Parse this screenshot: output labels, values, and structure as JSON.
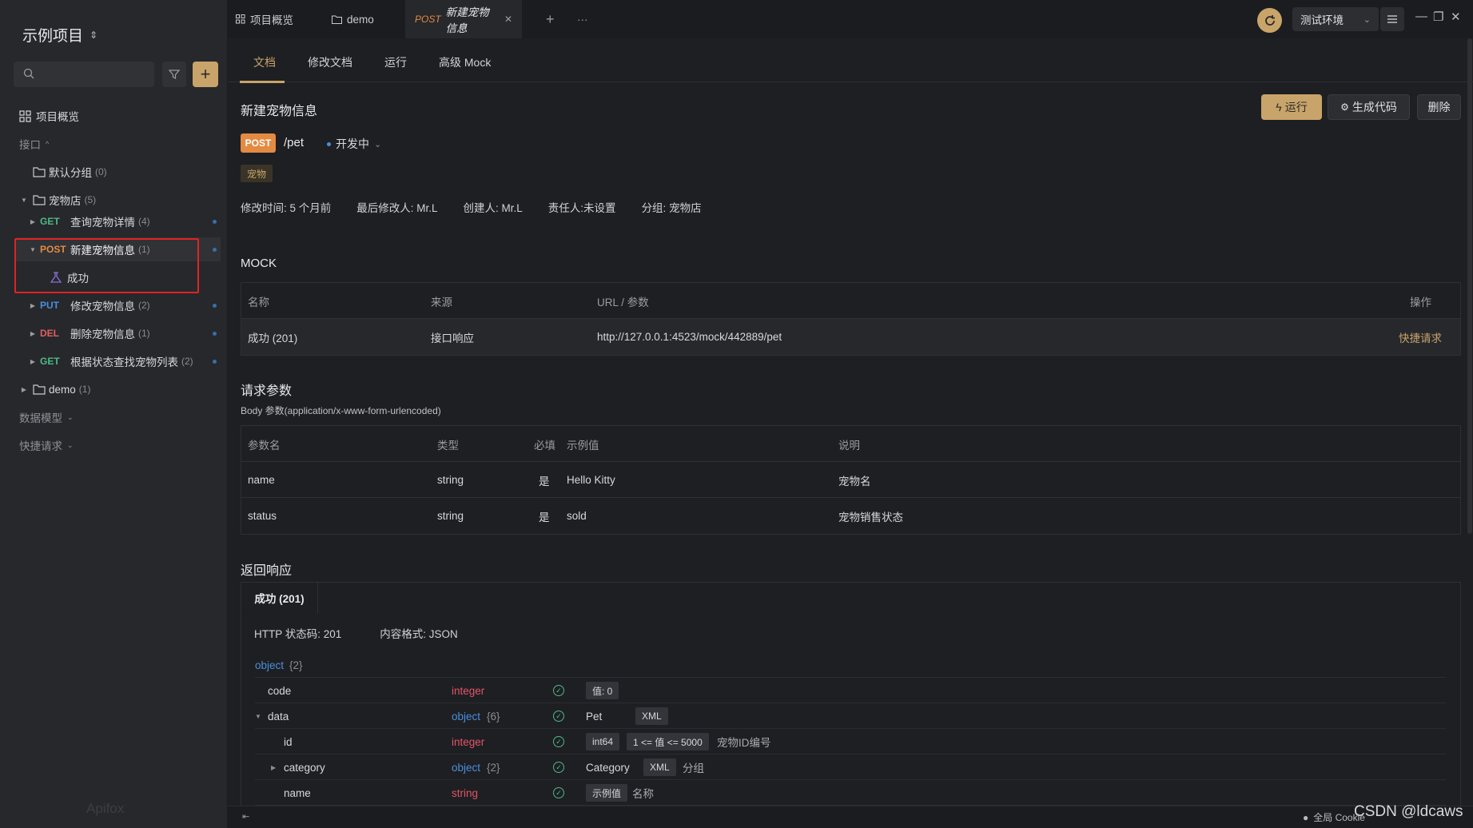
{
  "sidebar": {
    "project_title": "示例项目",
    "project_switch_glyph": "⇕",
    "search_placeholder": "",
    "add_glyph": "+",
    "overview_label": "项目概览",
    "section_api": "接口",
    "default_group": {
      "label": "默认分组",
      "count": "(0)"
    },
    "pet_folder": {
      "label": "宠物店",
      "count": "(5)"
    },
    "items": [
      {
        "method": "GET",
        "label": "查询宠物详情",
        "count": "(4)"
      },
      {
        "method": "POST",
        "label": "新建宠物信息",
        "count": "(1)"
      },
      {
        "method": "PUT",
        "label": "修改宠物信息",
        "count": "(2)"
      },
      {
        "method": "DEL",
        "label": "删除宠物信息",
        "count": "(1)"
      },
      {
        "method": "GET",
        "label": "根据状态查找宠物列表",
        "count": "(2)"
      }
    ],
    "success_case": "成功",
    "demo_folder": {
      "label": "demo",
      "count": "(1)"
    },
    "section_models": "数据模型",
    "section_quick": "快捷请求",
    "logo_text": "Apifox"
  },
  "topbar": {
    "tab_overview": "项目概览",
    "tab_demo": "demo",
    "tab_active_method": "POST",
    "tab_active_label": "新建宠物信息",
    "close_glyph": "✕",
    "plus_glyph": "+",
    "more_glyph": "···",
    "env_label": "测试环境"
  },
  "subtabs": [
    "文档",
    "修改文档",
    "运行",
    "高级 Mock"
  ],
  "doc": {
    "title": "新建宠物信息",
    "btn_run": "运行",
    "btn_gen": "生成代码",
    "btn_delete": "删除",
    "method": "POST",
    "path": "/pet",
    "status": "开发中",
    "tag": "宠物",
    "meta": [
      "修改时间: 5 个月前",
      "最后修改人: Mr.L",
      "创建人: Mr.L",
      "责任人:未设置",
      "分组: 宠物店"
    ]
  },
  "mock": {
    "heading": "MOCK",
    "headers": [
      "名称",
      "来源",
      "URL / 参数",
      "操作"
    ],
    "row": {
      "name": "成功 (201)",
      "source": "接口响应",
      "url": "http://127.0.0.1:4523/mock/442889/pet",
      "action": "快捷请求"
    }
  },
  "params": {
    "heading": "请求参数",
    "body_note": "Body 参数(application/x-www-form-urlencoded)",
    "headers": [
      "参数名",
      "类型",
      "必填",
      "示例值",
      "说明"
    ],
    "rows": [
      {
        "name": "name",
        "type": "string",
        "required": "是",
        "example": "Hello Kitty",
        "desc": "宠物名"
      },
      {
        "name": "status",
        "type": "string",
        "required": "是",
        "example": "sold",
        "desc": "宠物销售状态"
      }
    ]
  },
  "response": {
    "heading": "返回响应",
    "tab": "成功 (201)",
    "http_status": "HTTP 状态码: 201",
    "content_type": "内容格式: JSON",
    "root": {
      "type": "object",
      "count": "{2}"
    },
    "fields": [
      {
        "name": "code",
        "type": "integer",
        "pills": [
          "值: 0"
        ],
        "desc": ""
      },
      {
        "name": "data",
        "type": "object",
        "count": "{6}",
        "pills": [
          "XML"
        ],
        "title": "Pet",
        "desc": ""
      },
      {
        "name": "id",
        "type": "integer",
        "pills": [
          "int64",
          "1 <= 值 <= 5000"
        ],
        "desc": "宠物ID编号"
      },
      {
        "name": "category",
        "type": "object",
        "count": "{2}",
        "pills": [
          "XML"
        ],
        "title": "Category",
        "desc": "分组"
      },
      {
        "name": "name",
        "type": "string",
        "pills": [
          "示例值"
        ],
        "desc": "名称"
      }
    ]
  },
  "footer": {
    "cookie": "全局 Cookie",
    "watermark": "CSDN @ldcaws"
  }
}
